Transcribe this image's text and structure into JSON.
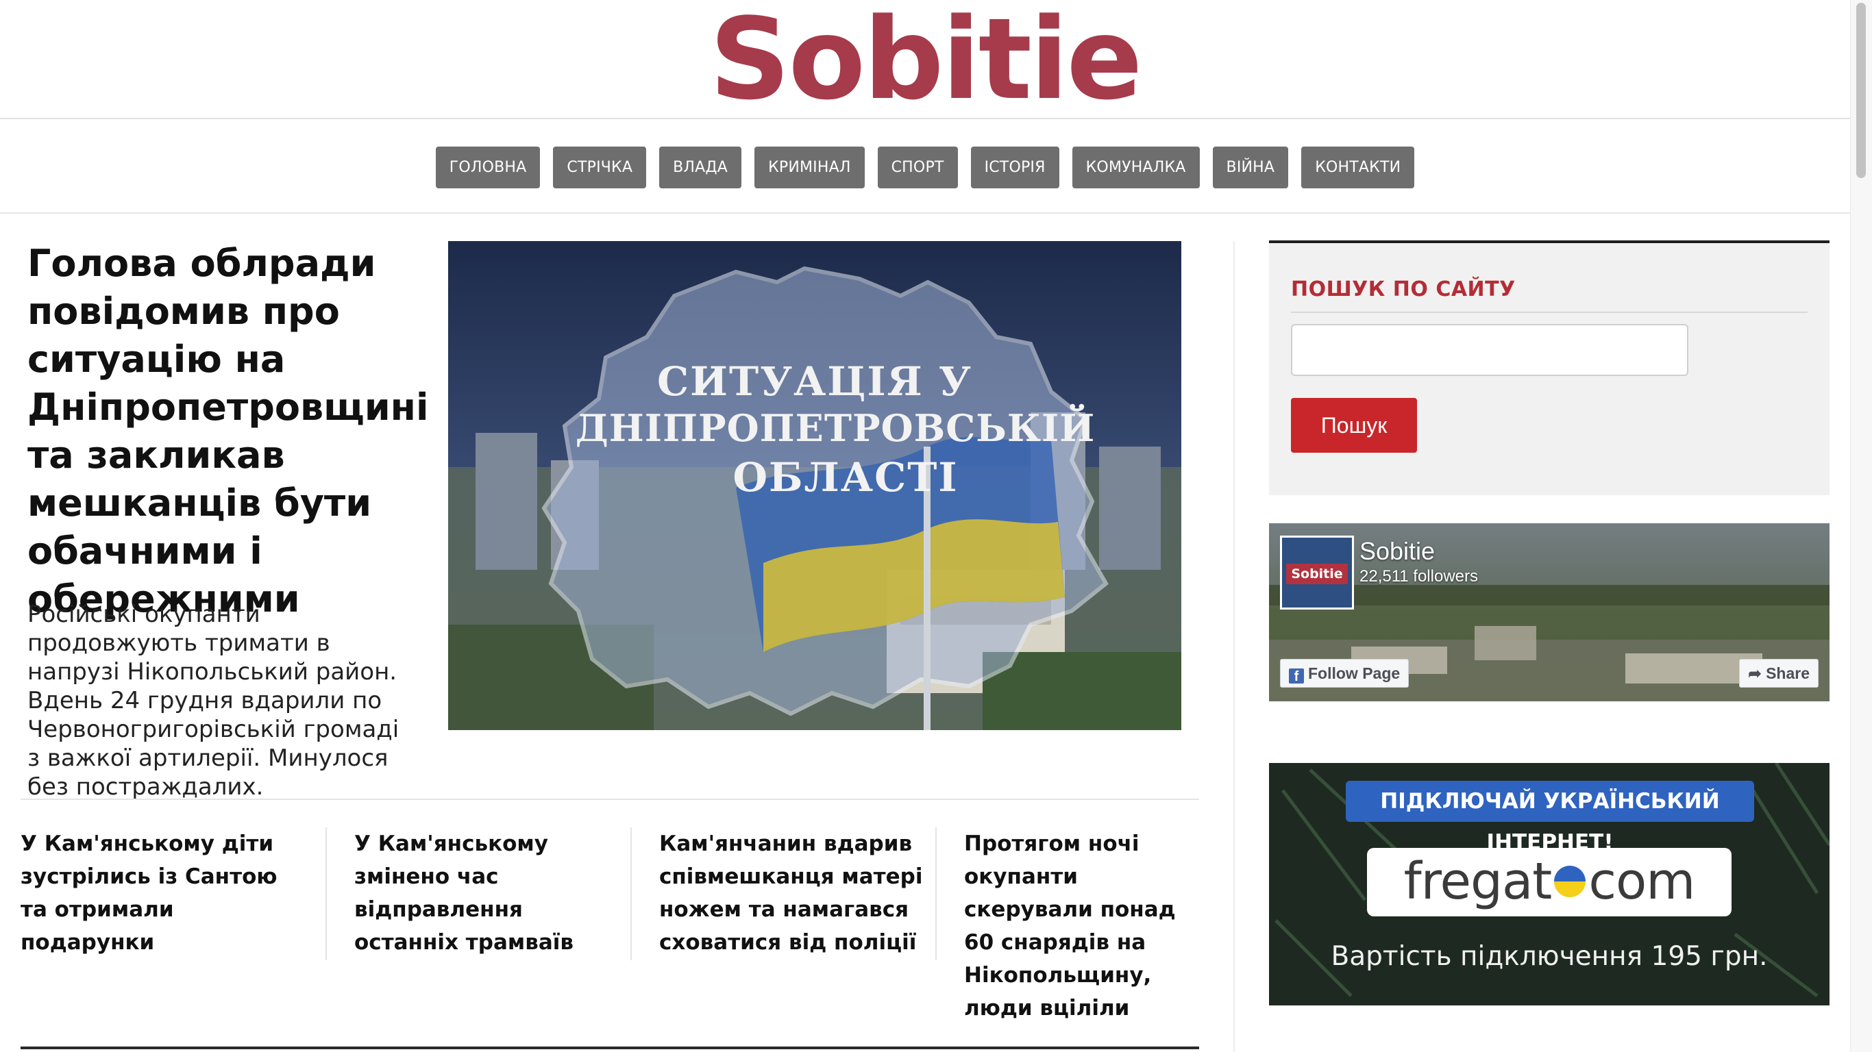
{
  "brand": {
    "logo_text": "Sobitie",
    "color": "#a63b4b"
  },
  "nav": {
    "items": [
      "ГОЛОВНА",
      "СТРІЧКА",
      "ВЛАДА",
      "КРИМІНАЛ",
      "СПОРТ",
      "ІСТОРІЯ",
      "КОМУНАЛКА",
      "ВІЙНА",
      "КОНТАКТИ"
    ],
    "color": "#6e6e6e"
  },
  "lead": {
    "title": "Голова облради повідомив про ситуацію на Дніпропетровщині та закликав мешканців бути обачними і обережними",
    "excerpt": "Російські окупанти продовжують тримати в напрузі Нікопольський район. Вдень 24 грудня вдарили по Червоногригорівській громаді з важкої артилерії. Минулося без постраждалих.",
    "image_text": [
      "СИТУАЦІЯ У",
      "ДНІПРОПЕТРОВСЬКІЙ",
      "ОБЛАСТІ"
    ]
  },
  "stories": [
    "У Кам'янському діти зустрілись із Сантою та отримали подарунки",
    "У Кам'янському змінено час відправлення останніх трамваїв",
    "Кам'янчанин вдарив співмешканця матері ножем та намагався сховатися від поліції",
    "Протягом ночі окупанти скерували понад 60 снарядів на Нікопольщину, люди вціліли"
  ],
  "search": {
    "title": "ПОШУК ПО САЙТУ",
    "title_color": "#b32d36",
    "input_value": "",
    "placeholder": "",
    "button_label": "Пошук",
    "button_color": "#c8262a"
  },
  "facebook": {
    "page_name": "Sobitie",
    "followers": "22,511 followers",
    "avatar_text": "Sobitie",
    "follow_label": "Follow Page",
    "share_label": "Share",
    "follow_icon": "facebook-f-icon",
    "share_icon": "share-arrow-icon"
  },
  "ad": {
    "headline": "ПІДКЛЮЧАЙ УКРАЇНСЬКИЙ ІНТЕРНЕТ!",
    "logo_left": "fregat",
    "logo_right": "com",
    "price": "Вартість підключення 195 грн."
  }
}
